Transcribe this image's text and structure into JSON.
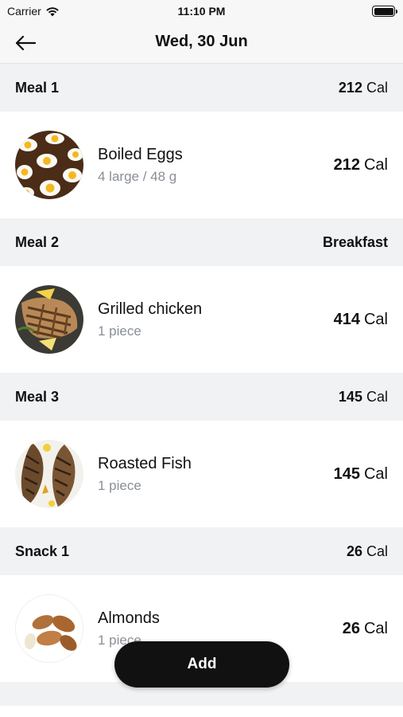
{
  "status_bar": {
    "carrier": "Carrier",
    "time": "11:10 PM"
  },
  "nav": {
    "title": "Wed, 30 Jun"
  },
  "sections": [
    {
      "title": "Meal 1",
      "header_value": "212",
      "header_unit": "Cal",
      "item": {
        "name": "Boiled Eggs",
        "portion": "4 large / 48 g",
        "cal_value": "212",
        "cal_unit": "Cal",
        "image_icon": "boiled-eggs"
      }
    },
    {
      "title": "Meal 2",
      "header_value": "Breakfast",
      "header_unit": "",
      "item": {
        "name": "Grilled chicken",
        "portion": "1 piece",
        "cal_value": "414",
        "cal_unit": "Cal",
        "image_icon": "grilled-chicken"
      }
    },
    {
      "title": "Meal 3",
      "header_value": "145",
      "header_unit": "Cal",
      "item": {
        "name": "Roasted Fish",
        "portion": "1 piece",
        "cal_value": "145",
        "cal_unit": "Cal",
        "image_icon": "roasted-fish"
      }
    },
    {
      "title": "Snack 1",
      "header_value": "26",
      "header_unit": "Cal",
      "item": {
        "name": "Almonds",
        "portion": "1 piece",
        "cal_value": "26",
        "cal_unit": "Cal",
        "image_icon": "almonds"
      }
    }
  ],
  "add_button": {
    "label": "Add"
  },
  "colors": {
    "header_bg": "#f1f2f4",
    "button_bg": "#111111",
    "portion_text": "#8a8f96"
  }
}
